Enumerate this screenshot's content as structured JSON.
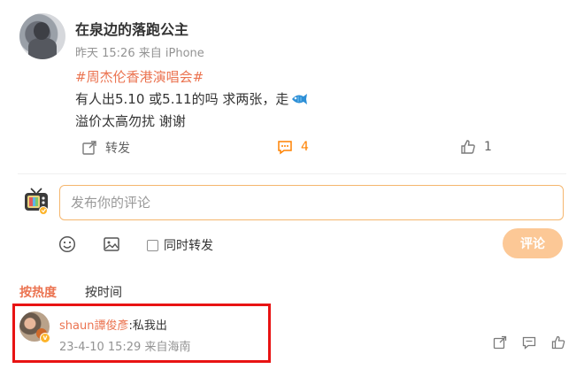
{
  "post": {
    "username": "在泉边的落跑公主",
    "time": "昨天 15:26",
    "source": "来自 iPhone",
    "topic": "#周杰伦香港演唱会#",
    "line1": "有人出5.10 或5.11的吗 求两张，走",
    "line2": "溢价太高勿扰 谢谢",
    "emoji_icon": "fish-icon"
  },
  "actions": {
    "repost_label": "转发",
    "comment_count": "4",
    "like_count": "1"
  },
  "composer": {
    "placeholder": "发布你的评论",
    "repost_label": "同时转发",
    "submit_label": "评论"
  },
  "sort": {
    "hot_label": "按热度",
    "time_label": "按时间"
  },
  "comment": {
    "name": "shaun譚俊彥",
    "text": ":私我出",
    "time": "23-4-10 15:29",
    "location": "来自海南"
  },
  "colors": {
    "accent": "#ff8200",
    "link": "#eb7350",
    "highlight": "#e81313",
    "submit_bg": "#fcc896"
  }
}
